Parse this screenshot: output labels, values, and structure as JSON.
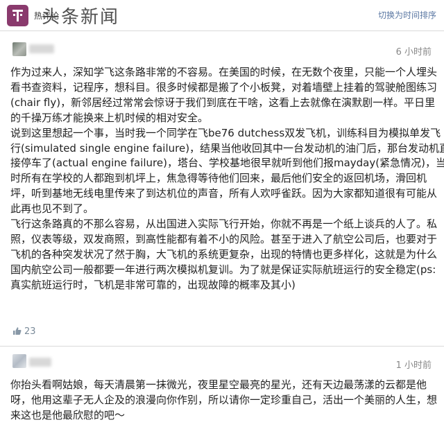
{
  "header": {
    "label": "热评论",
    "watermark": "头条新闻",
    "sort_link": "切换为时间排序"
  },
  "comments": [
    {
      "time": "6 小时前",
      "lines": [
        "作为过来人，深知学飞这条路非常的不容易。在美国的时候，在无数个夜里，只能一个人埋头",
        "看书查资料，记程序，想科目。很多时候都是搬了个小板凳，对着墙壁上挂着的驾驶舱图练习",
        "(chair fly)，新邻居经过常常会惊讶于我们到底在干啥，这看上去就像在演默剧一样。平日里",
        "的千操万练才能换来上机时候的相对安全。",
        "说到这里想起一个事，当时我一个同学在飞be76 dutchess双发飞机，训练科目为模拟单发飞",
        "行(simulated single engine failure)，结果当他收回其中一台发动机的油门后，那台发动机直",
        "接停车了(actual engine failure)，塔台、学校基地很早就听到他们报mayday(紧急情况)，当",
        "时所有在学校的人都跑到机坪上，焦急得等待他们回来，最后他们安全的返回机场，滑回机",
        "坪，听到基地无线电里传来了到达机位的声音，所有人欢呼雀跃。因为大家都知道很有可能从",
        "此再也见不到了。",
        "飞行这条路真的不那么容易，从出国进入实际飞行开始，你就不再是一个纸上谈兵的人了。私",
        "照，仪表等级，双发商照，到高性能都有着不小的风险。甚至于进入了航空公司后，也要对于",
        "飞机的各种突发状况了然于胸，大飞机的系统更复杂，出现的特情也更多样化，这就是为什么",
        "国内航空公司一般都要一年进行两次模拟机复训。为了就是保证实际航班运行的安全稳定(ps:",
        "真实航班运行时，飞机是非常可靠的，出现故障的概率及其小)"
      ],
      "likes": "23"
    },
    {
      "time": "1 小时前",
      "lines": [
        "你抬头看啊姑娘，每天清晨第一抹微光，夜里星空最亮的星光，还有天边最荡漾的云都是他",
        "呀，他用这辈子无人企及的浪漫向你作别，所以请你一定珍重自己，活出一个美丽的人生，想",
        "来这也是他最欣慰的吧～"
      ]
    }
  ]
}
